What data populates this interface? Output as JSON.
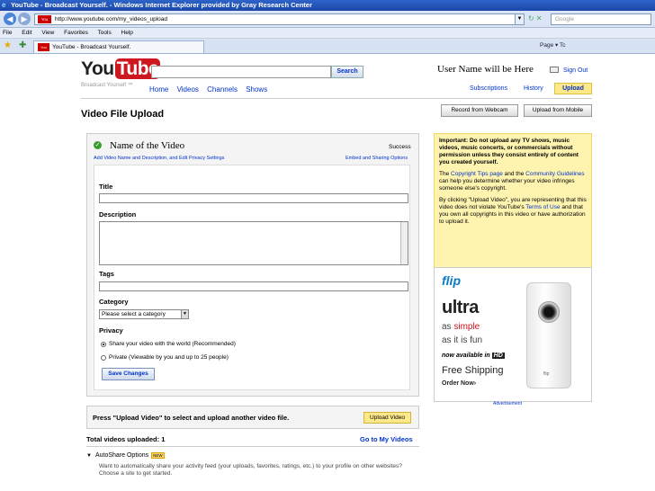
{
  "window": {
    "title": "YouTube - Broadcast Yourself. - Windows Internet Explorer provided by Gray Research Center",
    "url": "http://www.youtube.com/my_videos_upload",
    "search_placeholder": "Google",
    "menu": [
      "File",
      "Edit",
      "View",
      "Favorites",
      "Tools",
      "Help"
    ],
    "tab_title": "YouTube - Broadcast Yourself.",
    "tab_tools": "Page ▾  Tc"
  },
  "header": {
    "logo_you": "You",
    "logo_tube": "Tube",
    "tagline": "Broadcast Yourself ™",
    "search_button": "Search",
    "nav": [
      "Home",
      "Videos",
      "Channels",
      "Shows"
    ],
    "username": "User Name will be Here",
    "sign_out": "Sign Out",
    "subscriptions": "Subscriptions",
    "history": "History",
    "upload": "Upload"
  },
  "page": {
    "title": "Video File Upload",
    "record_button": "Record from Webcam",
    "upload_mobile_button": "Upload from Mobile"
  },
  "form": {
    "video_name": "Name of the Video",
    "status": "Success",
    "add_info_link": "Add Video Name and Description, and Edit Privacy Settings",
    "embed_link": "Embed and Sharing Options",
    "title_label": "Title",
    "title_value": "",
    "description_label": "Description",
    "description_value": "",
    "tags_label": "Tags",
    "tags_value": "",
    "category_label": "Category",
    "category_selected": "Please select a category",
    "privacy_label": "Privacy",
    "privacy_public": "Share your video with the world (Recommended)",
    "privacy_private": "Private (Viewable by you and up to 25 people)",
    "save_button": "Save Changes"
  },
  "important": {
    "warning": "Important: Do not upload any TV shows, music videos, music concerts, or commercials without permission unless they consist entirely of content you created yourself.",
    "p2_a": "The ",
    "p2_link1": "Copyright Tips page",
    "p2_b": " and the ",
    "p2_link2": "Community Guidelines",
    "p2_c": " can help you determine whether your video infringes someone else's copyright.",
    "p3_a": "By clicking \"Upload Video\", you are representing that this video does not violate YouTube's ",
    "p3_link": "Terms of Use",
    "p3_b": " and that you own all copyrights in this video or have authorization to upload it."
  },
  "ad": {
    "brand": "flip",
    "product": "ultra",
    "line1_a": "as ",
    "line1_b": "simple",
    "line2": "as it is fun",
    "available_a": "now available in ",
    "available_b": "HD",
    "shipping": "Free Shipping",
    "order": "Order Now›",
    "cam_brand": "flip",
    "label": "Advertisement"
  },
  "bottom": {
    "press_text": "Press \"Upload Video\" to select and upload another video file.",
    "upload_video_button": "Upload Video",
    "total": "Total videos uploaded: 1",
    "goto": "Go to My Videos",
    "autoshare_title": "AutoShare Options",
    "new_badge": "NEW",
    "autoshare_desc": "Want to automatically share your activity feed (your uploads, favorites, ratings, etc.) to your profile on other websites? Choose a site to get started."
  }
}
